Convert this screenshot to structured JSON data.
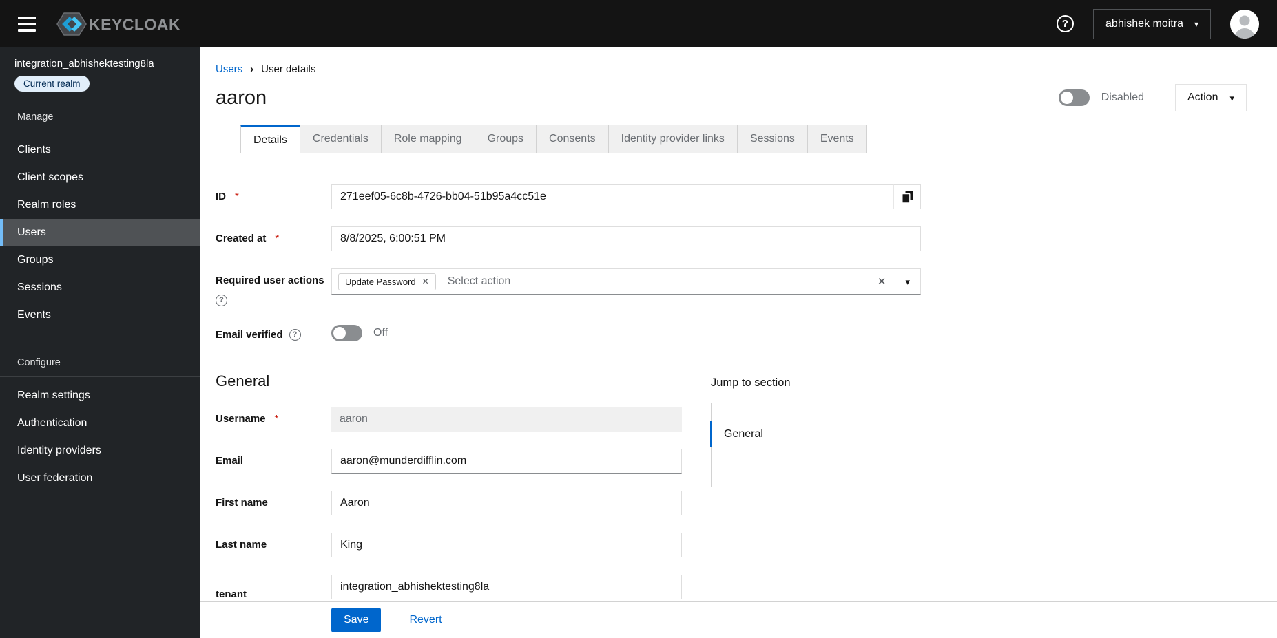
{
  "header": {
    "brand": "KEYCLOAK",
    "user_name": "abhishek moitra"
  },
  "sidebar": {
    "realm_name": "integration_abhishektesting8la",
    "realm_badge": "Current realm",
    "sections": [
      {
        "label": "Manage",
        "items": [
          "Clients",
          "Client scopes",
          "Realm roles",
          "Users",
          "Groups",
          "Sessions",
          "Events"
        ]
      },
      {
        "label": "Configure",
        "items": [
          "Realm settings",
          "Authentication",
          "Identity providers",
          "User federation"
        ]
      }
    ],
    "active_item": "Users"
  },
  "breadcrumb": {
    "parent": "Users",
    "current": "User details"
  },
  "page": {
    "title": "aaron",
    "status_toggle_label": "Disabled",
    "action_button": "Action"
  },
  "tabs": {
    "active": "Details",
    "items": [
      "Details",
      "Credentials",
      "Role mapping",
      "Groups",
      "Consents",
      "Identity provider links",
      "Sessions",
      "Events"
    ]
  },
  "form": {
    "required_marker": "*",
    "id": {
      "label": "ID",
      "value": "271eef05-6c8b-4726-bb04-51b95a4cc51e"
    },
    "created_at": {
      "label": "Created at",
      "value": "8/8/2025, 6:00:51 PM"
    },
    "required_user_actions": {
      "label": "Required user actions",
      "chip": "Update Password",
      "placeholder": "Select action"
    },
    "email_verified": {
      "label": "Email verified",
      "state": "Off"
    },
    "general_section": {
      "title": "General"
    },
    "username": {
      "label": "Username",
      "value": "aaron"
    },
    "email": {
      "label": "Email",
      "value": "aaron@munderdifflin.com"
    },
    "first_name": {
      "label": "First name",
      "value": "Aaron"
    },
    "last_name": {
      "label": "Last name",
      "value": "King"
    },
    "tenant": {
      "label": "tenant",
      "value": "integration_abhishektesting8la"
    }
  },
  "jump_to_section": {
    "title": "Jump to section",
    "items": [
      "General"
    ]
  },
  "footer": {
    "save": "Save",
    "revert": "Revert"
  },
  "icons": {
    "help": "?",
    "caret_down": "▾",
    "close": "✕",
    "chevron_right": "›"
  },
  "colors": {
    "accent": "#0066cc",
    "masthead_bg": "#141414",
    "sidebar_bg": "#212427",
    "nav_active_accent": "#73bcf7",
    "danger": "#c9190b"
  }
}
